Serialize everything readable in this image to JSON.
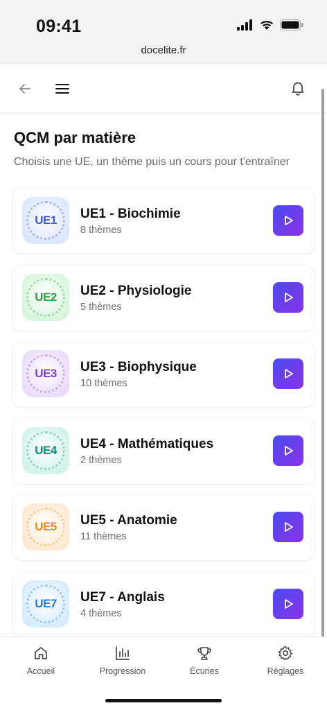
{
  "status": {
    "time": "09:41",
    "url": "docelite.fr"
  },
  "header": {
    "back_icon": "arrow-left-icon",
    "menu_icon": "hamburger-menu-icon",
    "notifications_icon": "bell-icon"
  },
  "page": {
    "title": "QCM par matière",
    "subtitle": "Choisis une UE, un thème puis un cours pour t'entraîner"
  },
  "subjects": [
    {
      "badge": "UE1",
      "title": "UE1 - Biochimie",
      "count": "8 thèmes",
      "color": "#3b5bdb",
      "bg": "#dbe6ff"
    },
    {
      "badge": "UE2",
      "title": "UE2 - Physiologie",
      "count": "5 thèmes",
      "color": "#2f9e44",
      "bg": "#d7f5dd"
    },
    {
      "badge": "UE3",
      "title": "UE3 - Biophysique",
      "count": "10 thèmes",
      "color": "#7e3fd1",
      "bg": "#eadcfb"
    },
    {
      "badge": "UE4",
      "title": "UE4 - Mathématiques",
      "count": "2 thèmes",
      "color": "#0c8a78",
      "bg": "#d2f2ea"
    },
    {
      "badge": "UE5",
      "title": "UE5 - Anatomie",
      "count": "11 thèmes",
      "color": "#f08c00",
      "bg": "#ffe8d2"
    },
    {
      "badge": "UE7",
      "title": "UE7 - Anglais",
      "count": "4 thèmes",
      "color": "#1c7ed6",
      "bg": "#d6ebff"
    }
  ],
  "nav": {
    "items": [
      {
        "label": "Accueil",
        "icon": "home-icon"
      },
      {
        "label": "Progression",
        "icon": "bar-chart-icon"
      },
      {
        "label": "Écuries",
        "icon": "trophy-icon"
      },
      {
        "label": "Réglages",
        "icon": "gear-icon"
      }
    ]
  },
  "colors": {
    "accent_start": "#4b4cf0",
    "accent_end": "#8b32e8"
  }
}
